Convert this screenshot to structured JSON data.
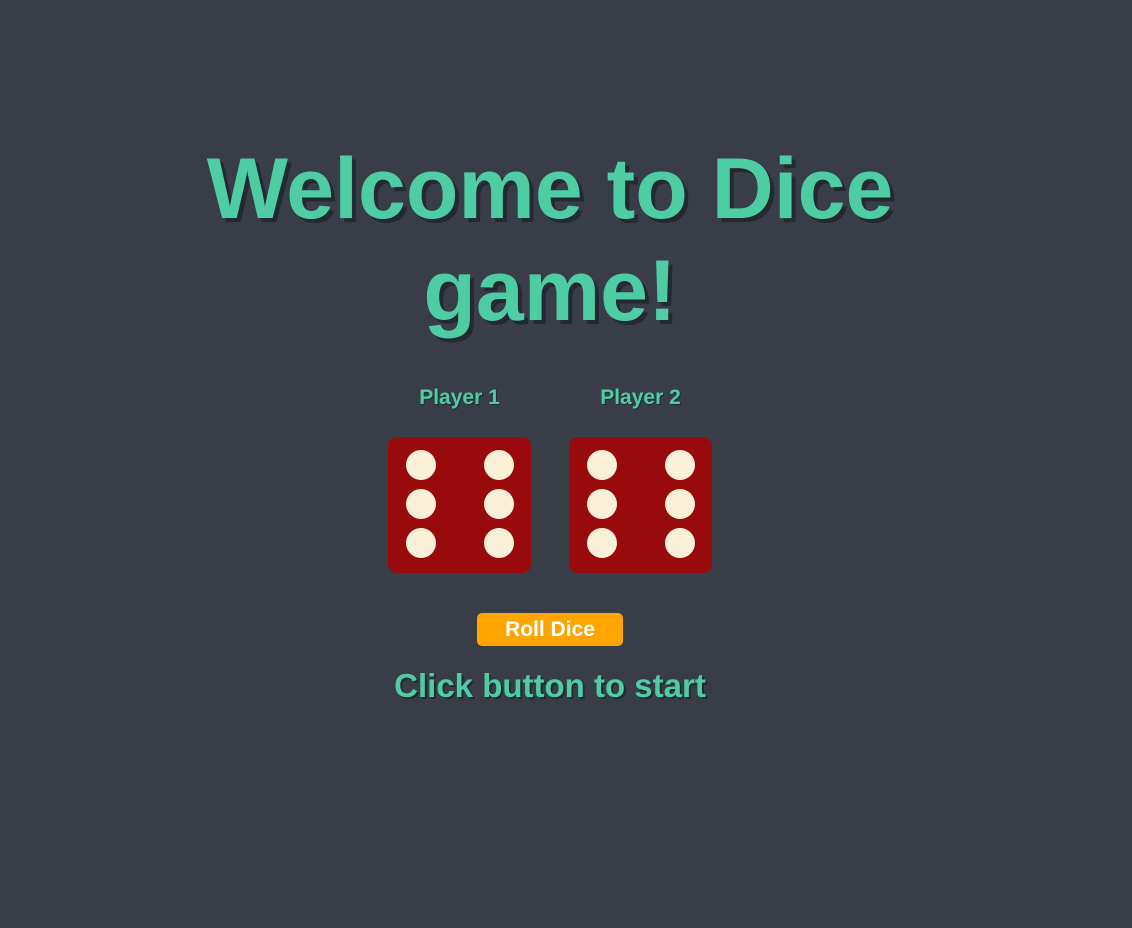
{
  "title": "Welcome to Dice game!",
  "players": [
    {
      "label": "Player 1",
      "die_value": 6
    },
    {
      "label": "Player 2",
      "die_value": 6
    }
  ],
  "roll_button_label": "Roll Dice",
  "status_text": "Click button to start",
  "colors": {
    "background": "#393d47",
    "accent": "#4ecca3",
    "die": "#990a0d",
    "pip": "#faf0d8",
    "button": "#ffa500",
    "button_text": "#ffffff"
  }
}
